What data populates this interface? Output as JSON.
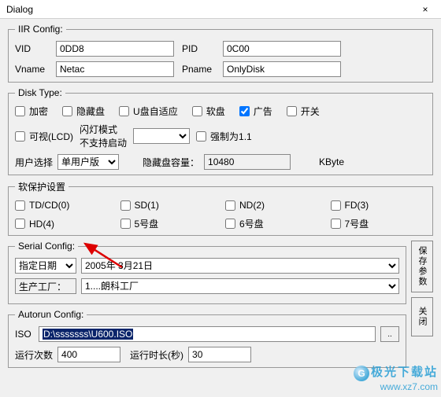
{
  "window": {
    "title": "Dialog",
    "close": "×"
  },
  "iir": {
    "legend": "IIR Config:",
    "vid_label": "VID",
    "vid_value": "0DD8",
    "pid_label": "PID",
    "pid_value": "0C00",
    "vname_label": "Vname",
    "vname_value": "Netac",
    "pname_label": "Pname",
    "pname_value": "OnlyDisk"
  },
  "disk": {
    "legend": "Disk Type:",
    "encrypt": "加密",
    "hidden": "隐藏盘",
    "uauto": "U盘自适应",
    "floppy": "软盘",
    "ad": "广告",
    "switch": "开关",
    "visible": "可视(LCD)",
    "flashmode": "闪灯模式",
    "nostart": "不支持启动",
    "force11": "强制为1.1",
    "usersel_label": "用户选择",
    "usersel_value": "单用户版",
    "hiddencap_label": "隐藏盘容量：",
    "hiddencap_value": "10480",
    "kbyte": "KByte"
  },
  "soft": {
    "legend": "软保护设置",
    "tdcd": "TD/CD(0)",
    "sd": "SD(1)",
    "nd": "ND(2)",
    "fd": "FD(3)",
    "hd": "HD(4)",
    "d5": "5号盘",
    "d6": "6号盘",
    "d7": "7号盘"
  },
  "serial": {
    "legend": "Serial Config:",
    "datemode": "指定日期",
    "date_value": "2005年 3月21日",
    "factory_label": "生产工厂：",
    "factory_value": "1....朗科工厂"
  },
  "sidebtn": {
    "save": "保存参数",
    "close": "关闭"
  },
  "autorun": {
    "legend": "Autorun Config:",
    "iso_label": "ISO",
    "iso_path": "D:\\sssssss\\U600.ISO",
    "browse": "..",
    "runcount_label": "运行次数",
    "runcount_value": "400",
    "runtime_label": "运行时长(秒)",
    "runtime_value": "30"
  },
  "watermark": {
    "line1": "极光下载站",
    "line2": "www.xz7.com"
  }
}
